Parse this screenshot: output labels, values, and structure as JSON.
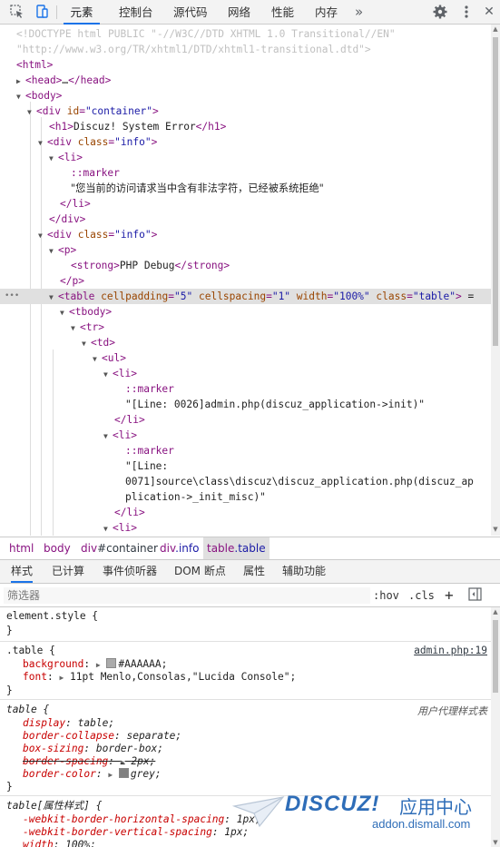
{
  "toolbar": {
    "inspect_icon": "inspect-cursor-icon",
    "device_icon": "device-toggle-icon",
    "tabs": [
      "元素",
      "控制台",
      "源代码",
      "网络",
      "性能",
      "内存"
    ],
    "more_glyph": "»",
    "settings_icon": "gear-icon",
    "menu_icon": "kebab-menu-icon"
  },
  "dom": {
    "doctype_line1": "<!DOCTYPE html PUBLIC \"-//W3C//DTD XHTML 1.0 Transitional//EN\"",
    "doctype_line2": "\"http://www.w3.org/TR/xhtml1/DTD/xhtml1-transitional.dtd\">",
    "html_tag": "<html>",
    "head_tag": "<head>",
    "head_close": "</head>",
    "ellipsis": "…",
    "body_tag": "<body>",
    "div_open": "<div",
    "attr_id": "id",
    "container_val": "\"container\"",
    "h1_open": "<h1>",
    "h1_text": "Discuz! System Error",
    "h1_close": "</h1>",
    "attr_class": "class",
    "info_val": "\"info\"",
    "li_open": "<li>",
    "marker": "::marker",
    "error_msg": "\"您当前的访问请求当中含有非法字符，已经被系统拒绝\"",
    "li_close": "</li>",
    "div_close": "</div>",
    "p_open": "<p>",
    "strong_open": "<strong>",
    "strong_text": "PHP Debug",
    "strong_close": "</strong>",
    "p_close": "</p>",
    "table_open": "<table",
    "attr_cellpadding": "cellpadding",
    "cellpadding_val": "\"5\"",
    "attr_cellspacing": "cellspacing",
    "cellspacing_val": "\"1\"",
    "attr_width": "width",
    "width_val": "\"100%\"",
    "table_class_val": "\"table\"",
    "eq_sign": "=",
    "dots": "•••",
    "tbody_open": "<tbody>",
    "tr_open": "<tr>",
    "td_open": "<td>",
    "ul_open": "<ul>",
    "line1_text": "\"[Line: 0026]admin.php(discuz_application->init)\"",
    "line2_text_a": "\"[Line:",
    "line2_text_b": "0071]source\\class\\discuz\\discuz_application.php(discuz_ap",
    "line2_text_c": "plication->_init_misc)\""
  },
  "breadcrumbs": [
    {
      "tag": "html",
      "rest": ""
    },
    {
      "tag": "body",
      "rest": ""
    },
    {
      "tag": "div",
      "rest": "#container"
    },
    {
      "tag": "div",
      "rest": ".info"
    },
    {
      "tag": "table",
      "rest": ".table"
    }
  ],
  "subtabs": [
    "样式",
    "已计算",
    "事件侦听器",
    "DOM 断点",
    "属性",
    "辅助功能"
  ],
  "filter": {
    "placeholder": "筛选器",
    "hov": ":hov",
    "cls": ".cls",
    "add": "+",
    "toggle_icon": "sidebar-toggle-icon"
  },
  "styles": {
    "element_style": "element.style {",
    "close_brace": "}",
    "table_selector": ".table {",
    "table_source": "admin.php:19",
    "background_prop": "background",
    "background_val": "#AAAAAA;",
    "background_color": "#aaaaaa",
    "font_prop": "font",
    "font_val": "11pt Menlo,Consolas,\"Lucida Console\";",
    "ua_selector": "table {",
    "ua_label": "用户代理样式表",
    "display_prop": "display",
    "display_val": "table;",
    "collapse_prop": "border-collapse",
    "collapse_val": "separate;",
    "sizing_prop": "box-sizing",
    "sizing_val": "border-box;",
    "spacing_prop": "border-spacing",
    "spacing_val": "2px;",
    "bcolor_prop": "border-color",
    "bcolor_val": "grey;",
    "bcolor_swatch": "#808080",
    "attr_selector": "table[属性样式] {",
    "hspacing_prop": "-webkit-border-horizontal-spacing",
    "hspacing_val": "1px;",
    "vspacing_prop": "-webkit-border-vertical-spacing",
    "vspacing_val": "1px;",
    "width_prop": "width",
    "width_val": "100%;"
  },
  "watermark": {
    "brand": "DISCUZ!",
    "cn": "应用中心",
    "url": "addon.dismall.com"
  }
}
